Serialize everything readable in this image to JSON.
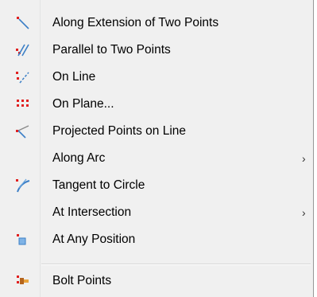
{
  "menu": {
    "items": [
      {
        "label": "Along Extension of Two Points",
        "icon": "extension-two-points-icon",
        "submenu": false
      },
      {
        "label": "Parallel to Two Points",
        "icon": "parallel-two-points-icon",
        "submenu": false
      },
      {
        "label": "On Line",
        "icon": "on-line-icon",
        "submenu": false
      },
      {
        "label": "On Plane...",
        "icon": "on-plane-icon",
        "submenu": false
      },
      {
        "label": "Projected Points on Line",
        "icon": "projected-points-icon",
        "submenu": false
      },
      {
        "label": "Along Arc",
        "icon": "",
        "submenu": true
      },
      {
        "label": "Tangent to Circle",
        "icon": "tangent-circle-icon",
        "submenu": false
      },
      {
        "label": "At Intersection",
        "icon": "",
        "submenu": true
      },
      {
        "label": "At Any Position",
        "icon": "any-position-icon",
        "submenu": false
      },
      {
        "label": "Bolt Points",
        "icon": "bolt-points-icon",
        "submenu": false
      }
    ],
    "submenu_arrow": "›"
  },
  "colors": {
    "menu_background": "#f0f0f0",
    "point_red": "#e02020",
    "line_blue": "#3c7fc6"
  }
}
